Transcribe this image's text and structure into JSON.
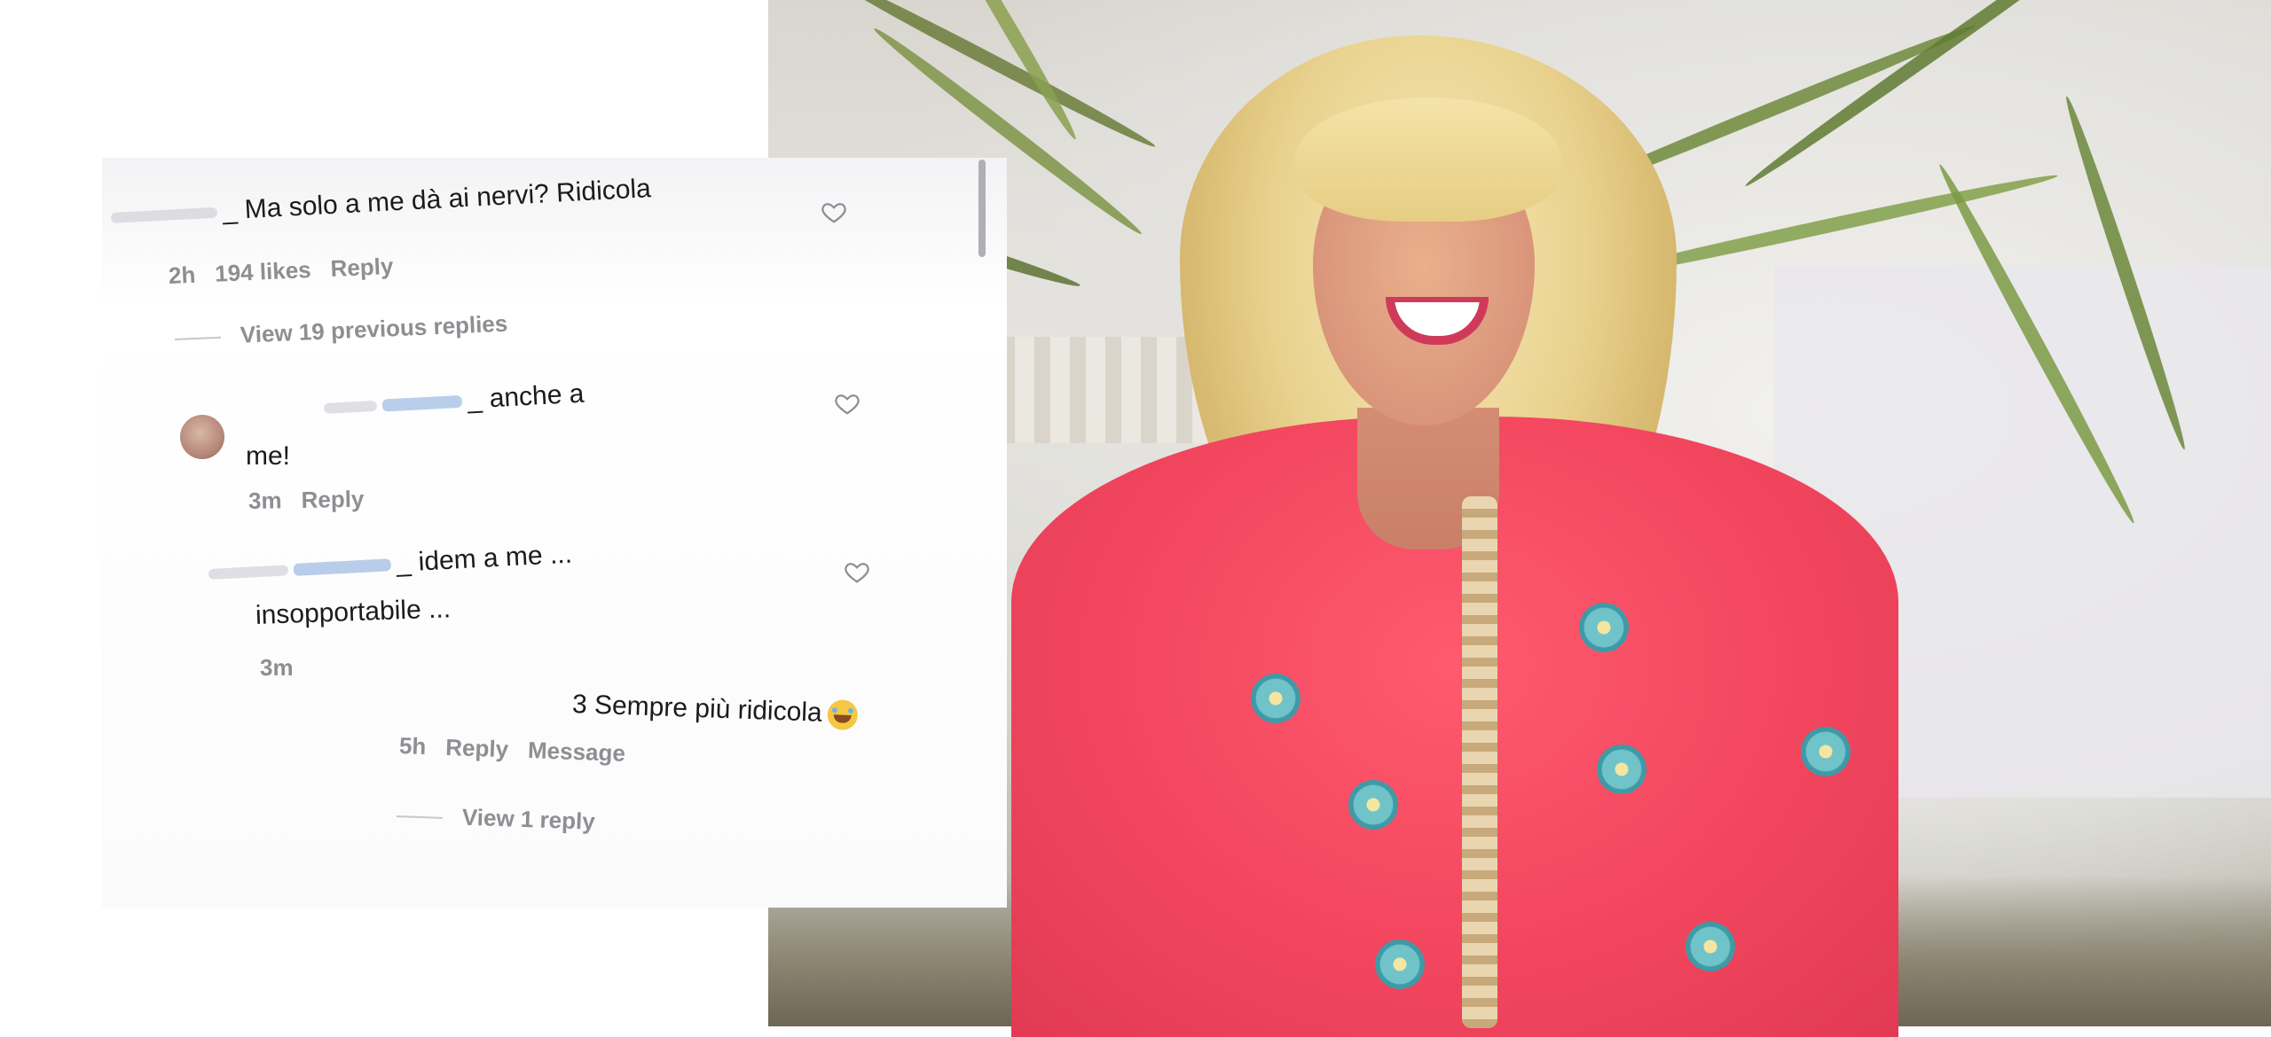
{
  "comments": [
    {
      "text": "_ Ma solo a me dà ai nervi? Ridicola",
      "time": "2h",
      "likes": "194 likes",
      "reply": "Reply"
    },
    {
      "view_previous": "View 19 previous replies"
    },
    {
      "text": "_ anche a",
      "text_cont": "me!",
      "time": "3m",
      "reply": "Reply"
    },
    {
      "text": "_ idem a me ...",
      "text_cont": "insopportabile ...",
      "time": "3m"
    },
    {
      "text": "3 Sempre più ridicola",
      "time": "5h",
      "reply": "Reply",
      "message": "Message",
      "view_replies": "View 1 reply"
    }
  ],
  "icons": {
    "like": "heart-outline-icon",
    "emoji": "laughing-tears-emoji"
  },
  "colors": {
    "text": "#1b1b1d",
    "muted": "#8e8e93",
    "dress": "#f2465e",
    "background": "#ffffff"
  }
}
